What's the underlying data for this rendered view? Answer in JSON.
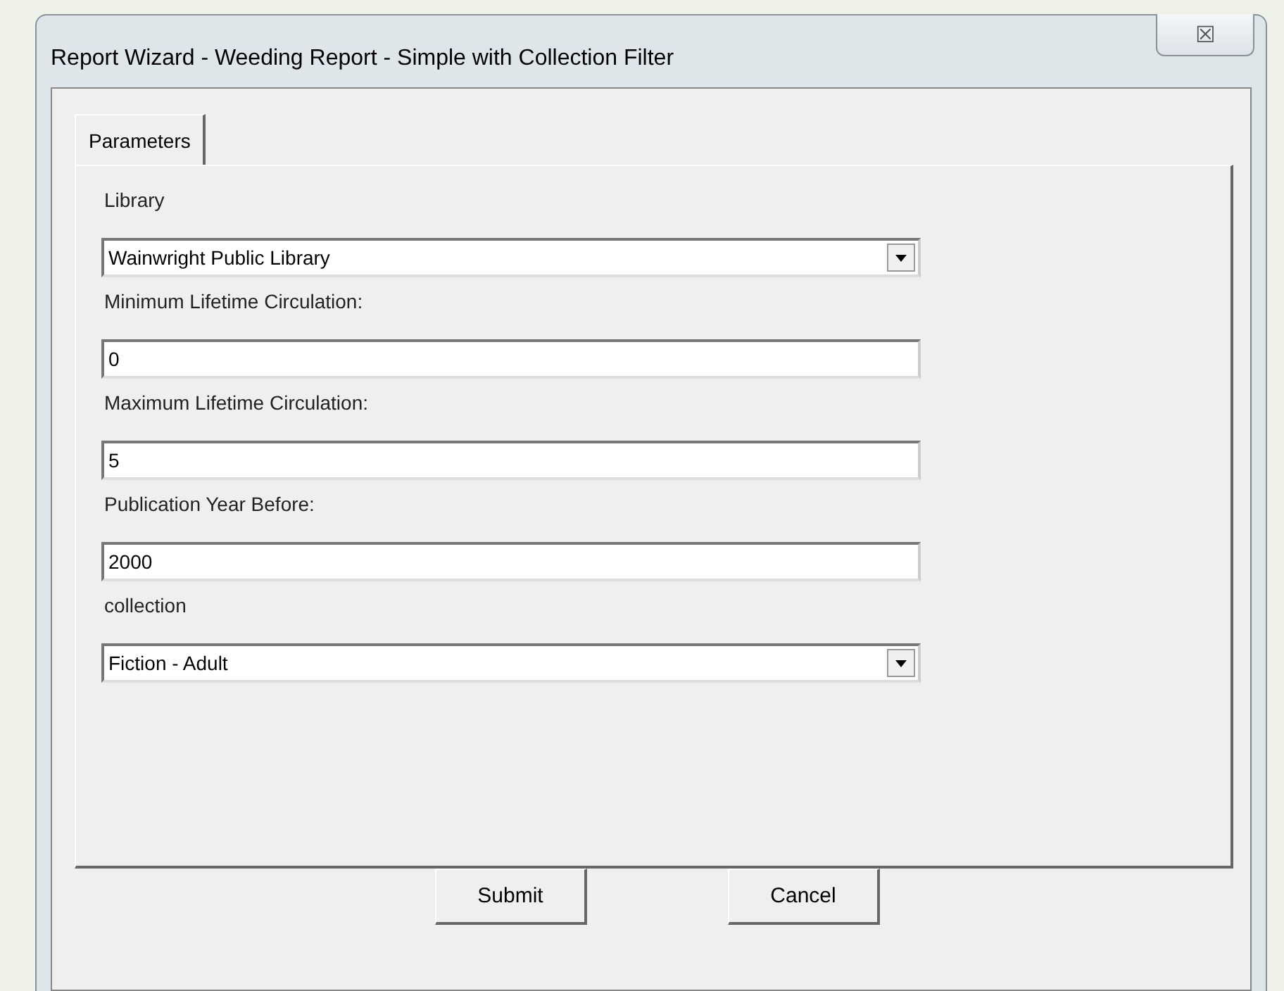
{
  "window": {
    "title": "Report Wizard - Weeding Report - Simple with Collection Filter",
    "close": "☒"
  },
  "tabs": [
    {
      "label": "Parameters",
      "selected": true
    }
  ],
  "fields": [
    {
      "label": "Library",
      "kind": "dropdown",
      "value": "Wainwright Public Library"
    },
    {
      "label": "Minimum Lifetime Circulation:",
      "kind": "text",
      "value": "0"
    },
    {
      "label": "Maximum Lifetime Circulation:",
      "kind": "text",
      "value": "5"
    },
    {
      "label": "Publication Year Before:",
      "kind": "text",
      "value": "2000"
    },
    {
      "label": "collection",
      "kind": "dropdown",
      "value": "Fiction - Adult"
    }
  ],
  "buttons": [
    "Submit",
    "Cancel"
  ]
}
